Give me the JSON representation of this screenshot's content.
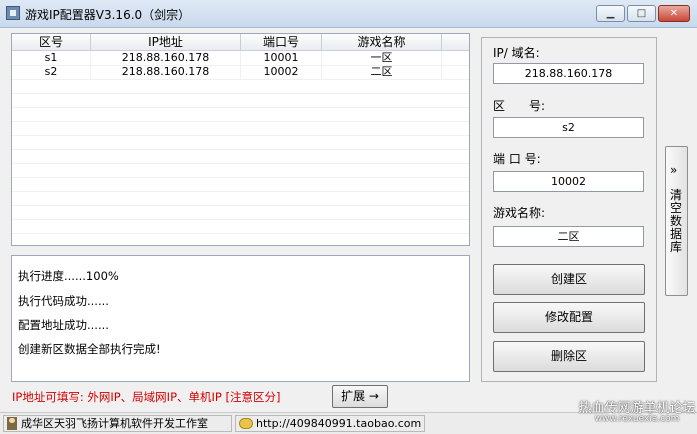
{
  "window": {
    "title": "游戏IP配置器V3.16.0（剑宗）",
    "controls": {
      "minimize": "▁",
      "maximize": "□",
      "close": "✕"
    }
  },
  "table": {
    "columns": [
      "区号",
      "IP地址",
      "端口号",
      "游戏名称"
    ],
    "rows": [
      [
        "s1",
        "218.88.160.178",
        "10001",
        "一区"
      ],
      [
        "s2",
        "218.88.160.178",
        "10002",
        "二区"
      ]
    ]
  },
  "log": {
    "lines": [
      "执行进度......100%",
      "执行代码成功......",
      "配置地址成功......",
      "创建新区数据全部执行完成!"
    ]
  },
  "form": {
    "ip_label": "IP/ 域名:",
    "ip_value": "218.88.160.178",
    "zone_label": "区　　号:",
    "zone_value": "s2",
    "port_label": "端 口 号:",
    "port_value": "10002",
    "name_label": "游戏名称:",
    "name_value": "二区"
  },
  "buttons": {
    "create": "创建区",
    "modify": "修改配置",
    "delete": "删除区",
    "expand": "扩展 →"
  },
  "side_tab": {
    "arrow": "»",
    "label": "清空数据库"
  },
  "hint": "IP地址可填写: 外网IP、局域网IP、单机IP [注意区分]",
  "status": {
    "studio": "成华区天羽飞扬计算机软件开发工作室",
    "url": "http://409840991.taobao.com"
  },
  "watermark": {
    "line1": "热血传网游单机论坛",
    "line2": "www.rexuexia.com"
  }
}
